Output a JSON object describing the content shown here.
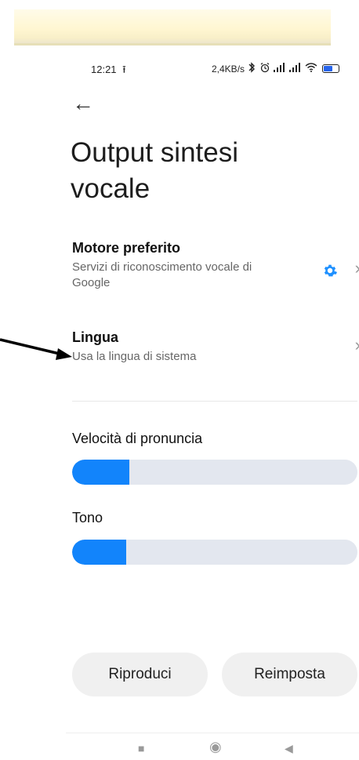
{
  "status": {
    "time": "12:21",
    "upload_glyph": "⭱",
    "network_speed": "2,4KB/s",
    "bluetooth": "bluetooth-icon",
    "alarm": "alarm-icon",
    "signal_1": "signal-icon",
    "signal_2": "signal-icon",
    "wifi": "wifi-icon",
    "battery_label": "53",
    "battery_level": 0.53
  },
  "header": {
    "back_glyph": "←",
    "title": "Output sintesi vocale"
  },
  "items": [
    {
      "title": "Motore preferito",
      "subtitle": "Servizi di riconoscimento vocale di Google",
      "icon": "settings-gear-icon",
      "chevron": "›"
    },
    {
      "title": "Lingua",
      "subtitle": "Usa la lingua di sistema",
      "chevron": "›"
    }
  ],
  "sliders": [
    {
      "label": "Velocità di pronuncia",
      "value": 0.2
    },
    {
      "label": "Tono",
      "value": 0.19
    }
  ],
  "buttons": {
    "play_label": "Riproduci",
    "reset_label": "Reimposta"
  },
  "nav": {
    "recent_glyph": "■",
    "home_glyph": "◉",
    "back_glyph": "◀"
  },
  "colors": {
    "accent": "#1284fb",
    "track": "#e3e7ef",
    "gear": "#1e90ff"
  }
}
